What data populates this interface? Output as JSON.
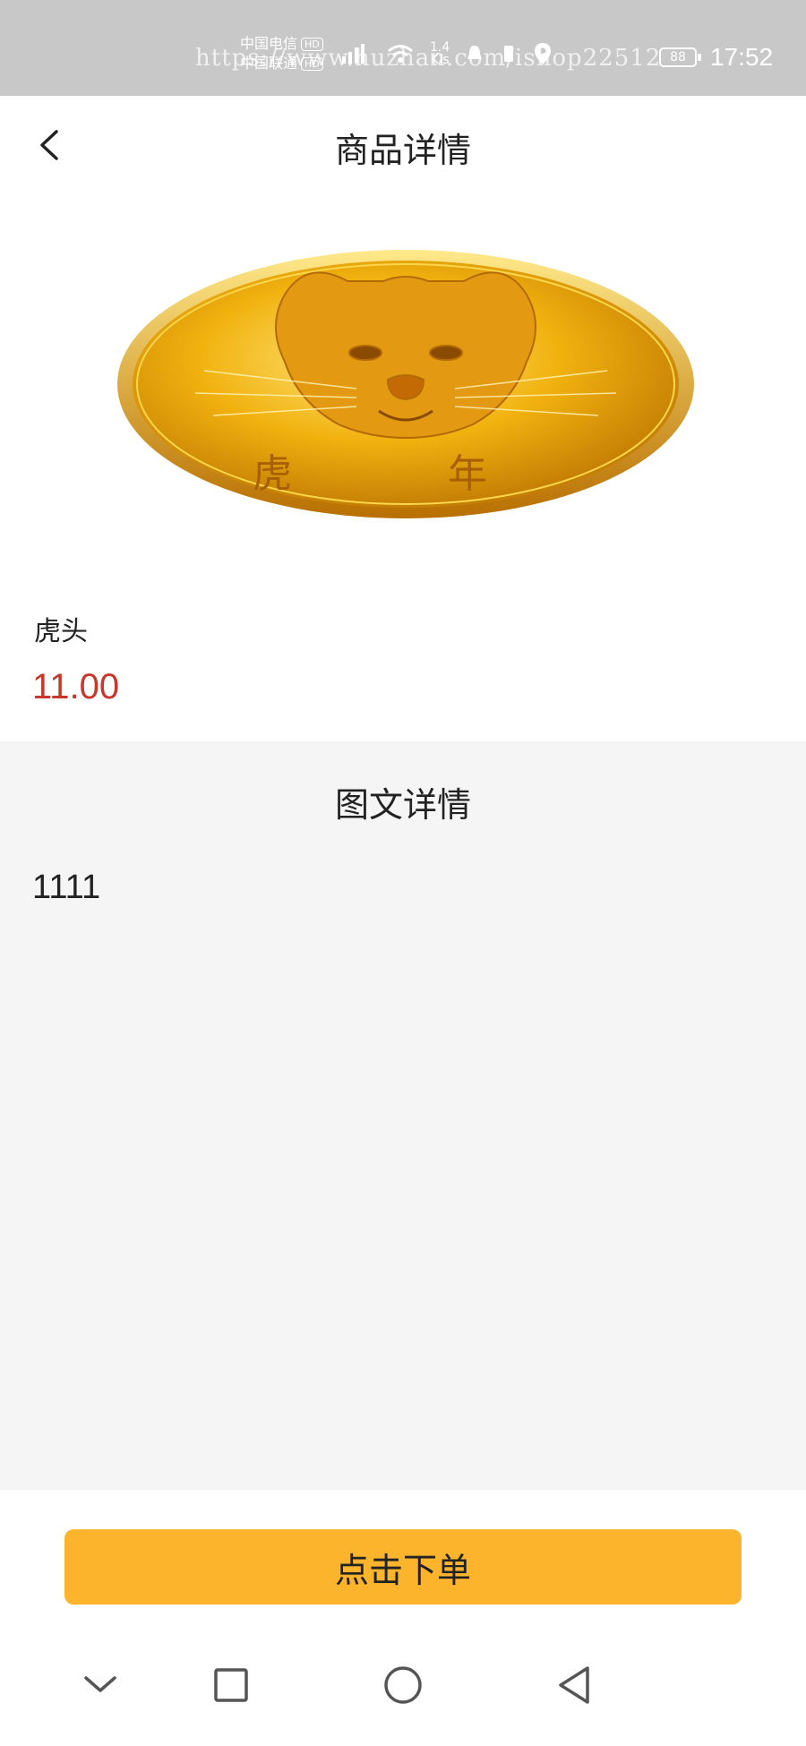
{
  "status_bar": {
    "carrier1": "中国电信",
    "carrier2": "中国联通",
    "hd": "HD",
    "network_speed": "1.4",
    "network_speed_unit": "K/s",
    "battery": "88",
    "time": "17:52",
    "watermark": "https://www.huzhan.com/ishop22512",
    "icons": [
      "signal-icon",
      "wifi-icon",
      "notification-icon",
      "vibrate-icon",
      "location-icon",
      "battery-icon"
    ]
  },
  "header": {
    "title": "商品详情",
    "back_icon": "chevron-left-icon"
  },
  "product": {
    "name": "虎头",
    "price": "11.00",
    "image_caption": "虎 年"
  },
  "detail": {
    "title": "图文详情",
    "content": "1111"
  },
  "order": {
    "button_label": "点击下单"
  },
  "navigation": {
    "icons": [
      "chevron-down-icon",
      "square-icon",
      "circle-icon",
      "triangle-back-icon"
    ]
  },
  "colors": {
    "status_bar_bg": "#c8c8c8",
    "price": "#c8372a",
    "detail_bg": "#f5f5f5",
    "order_button": "#fcb42d"
  }
}
